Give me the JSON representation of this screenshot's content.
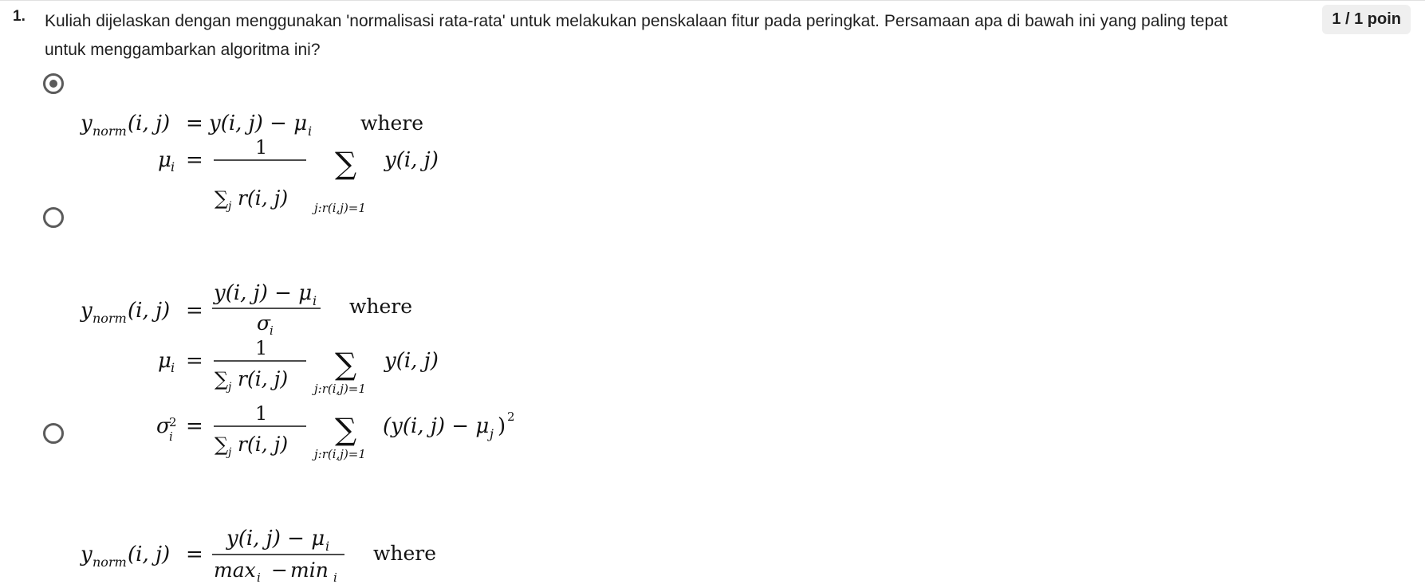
{
  "question": {
    "number": "1.",
    "text": "Kuliah dijelaskan dengan menggunakan 'normalisasi rata-rata' untuk melakukan penskalaan fitur pada peringkat. Persamaan apa di bawah ini yang paling tepat untuk menggambarkan algoritma ini?",
    "points": "1 / 1 poin"
  },
  "options": [
    {
      "selected": true
    },
    {
      "selected": false
    },
    {
      "selected": false
    }
  ],
  "math": {
    "where": "where",
    "one": "1",
    "ynorm_y": "y",
    "ynorm_sub": "norm",
    "ij": "(i, j)",
    "eq": "=",
    "minus_mu_i": "y(i, j) − μ",
    "mu": "μ",
    "sub_i": "i",
    "sub_j": "j",
    "sigma": "σ",
    "sup_2": "2",
    "sum": "∑",
    "r_ij": "r(i, j)",
    "sum_range": "j:r(i,j)=1",
    "y_ij": "y(i, j)",
    "sq_open": "(y(i, j) − μ",
    "sq_close": ")",
    "max": "max",
    "min": "min",
    "minus": "−"
  }
}
